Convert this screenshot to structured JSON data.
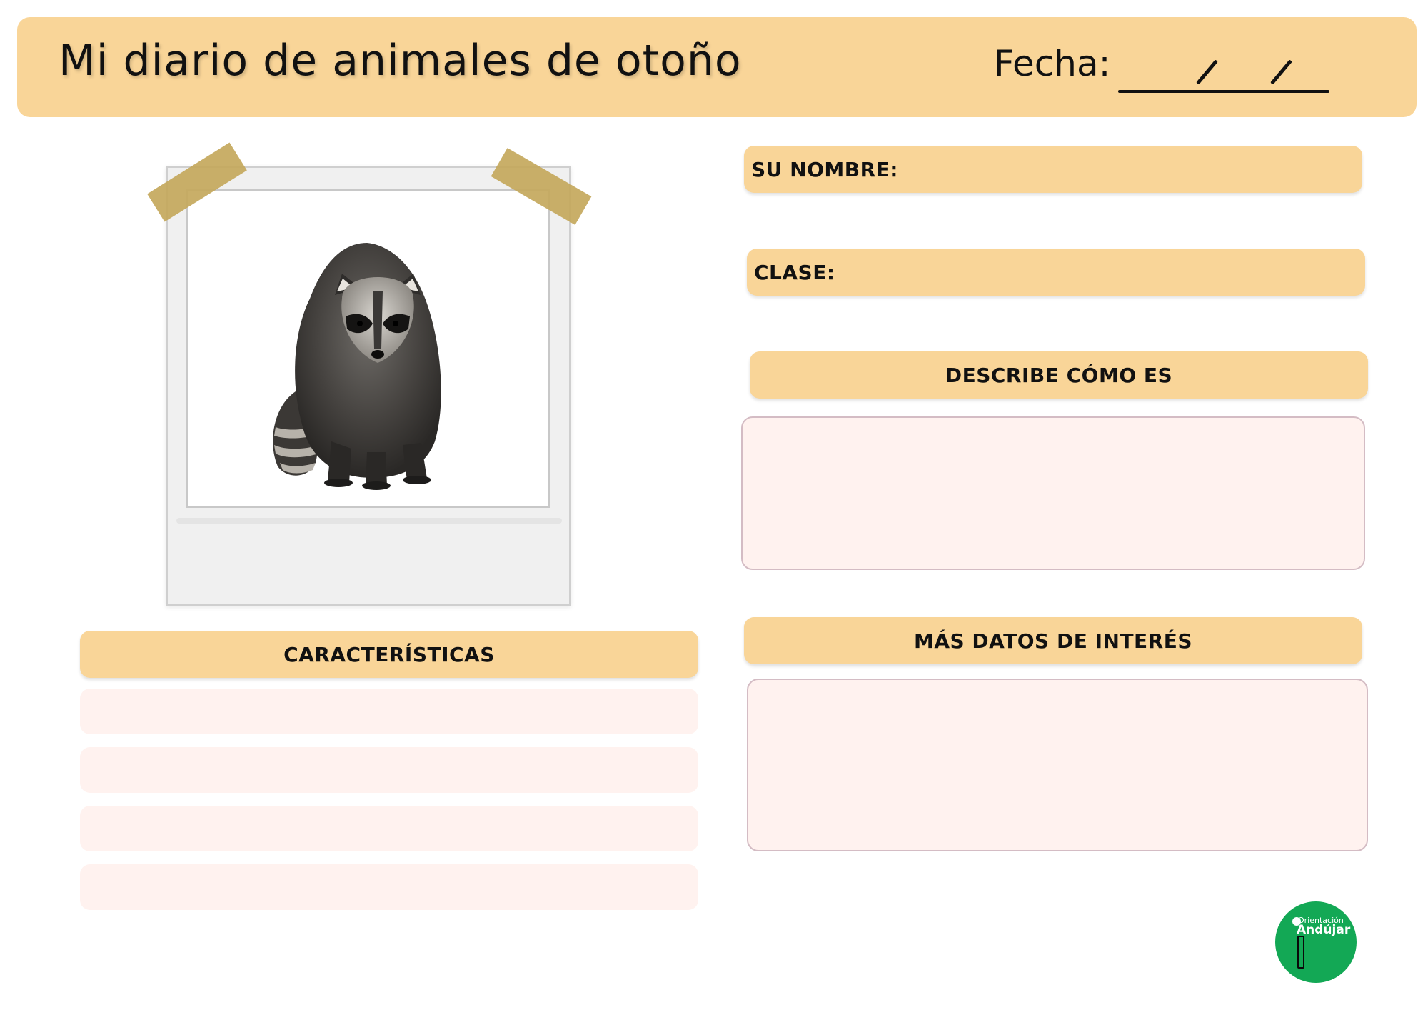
{
  "header": {
    "title": "Mi diario de animales de otoño",
    "date_label": "Fecha:",
    "date_separator_1": "/",
    "date_separator_2": "/"
  },
  "form": {
    "name_label": "SU NOMBRE:",
    "class_label": "CLASE:",
    "describe_label": "DESCRIBE CÓMO ES",
    "features_label": "CARACTERÍSTICAS",
    "more_info_label": "MÁS DATOS DE INTERÉS"
  },
  "logo": {
    "line1": "Orientación",
    "line2": "Andújar"
  },
  "colors": {
    "accent": "#f9d598",
    "box_fill": "#fff2ef",
    "logo_green": "#13a855"
  },
  "icons": {
    "photo": "raccoon-photo",
    "tape": "tape-strip-icon",
    "logo_pencil": "pencil-icon"
  }
}
